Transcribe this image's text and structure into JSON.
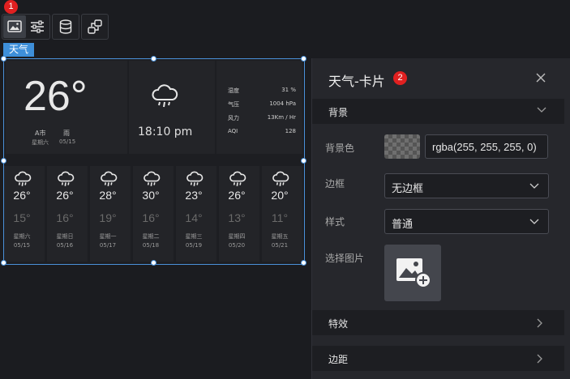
{
  "toolbar": {
    "badge": "1",
    "buttons": [
      {
        "icon": "image-settings-icon",
        "active": true
      },
      {
        "icon": "sliders-icon",
        "active": false
      },
      {
        "icon": "database-icon",
        "active": false
      },
      {
        "icon": "interaction-icon",
        "active": false
      }
    ]
  },
  "widget": {
    "tag": "天气",
    "current": {
      "temp": "26°",
      "city": "A市",
      "weather": "雨",
      "weekday": "星期六",
      "date": "05/15",
      "time": "18:10 pm",
      "icon": "rain-cloud-icon"
    },
    "stats": [
      {
        "key": "湿度",
        "value": "31 %"
      },
      {
        "key": "气压",
        "value": "1004 hPa"
      },
      {
        "key": "风力",
        "value": "13Km / Hr"
      },
      {
        "key": "AQI",
        "value": "128"
      }
    ],
    "forecast": [
      {
        "hi": "26°",
        "lo": "15°",
        "weekday": "星期六",
        "date": "05/15"
      },
      {
        "hi": "26°",
        "lo": "16°",
        "weekday": "星期日",
        "date": "05/16"
      },
      {
        "hi": "28°",
        "lo": "19°",
        "weekday": "星期一",
        "date": "05/17"
      },
      {
        "hi": "30°",
        "lo": "16°",
        "weekday": "星期二",
        "date": "05/18"
      },
      {
        "hi": "23°",
        "lo": "14°",
        "weekday": "星期三",
        "date": "05/19"
      },
      {
        "hi": "26°",
        "lo": "13°",
        "weekday": "星期四",
        "date": "05/20"
      },
      {
        "hi": "20°",
        "lo": "11°",
        "weekday": "星期五",
        "date": "05/21"
      }
    ]
  },
  "panel": {
    "title": "天气-卡片",
    "badge": "2",
    "sections": {
      "background": "背景",
      "effects": "特效",
      "margin": "边距"
    },
    "fields": {
      "bg_color_label": "背景色",
      "bg_color_value": "rgba(255, 255, 255, 0)",
      "border_label": "边框",
      "border_value": "无边框",
      "style_label": "样式",
      "style_value": "普通",
      "image_label": "选择图片"
    }
  },
  "colors": {
    "accent": "#3e8fd9",
    "badge": "#e02020",
    "panel_bg": "#26272c"
  }
}
